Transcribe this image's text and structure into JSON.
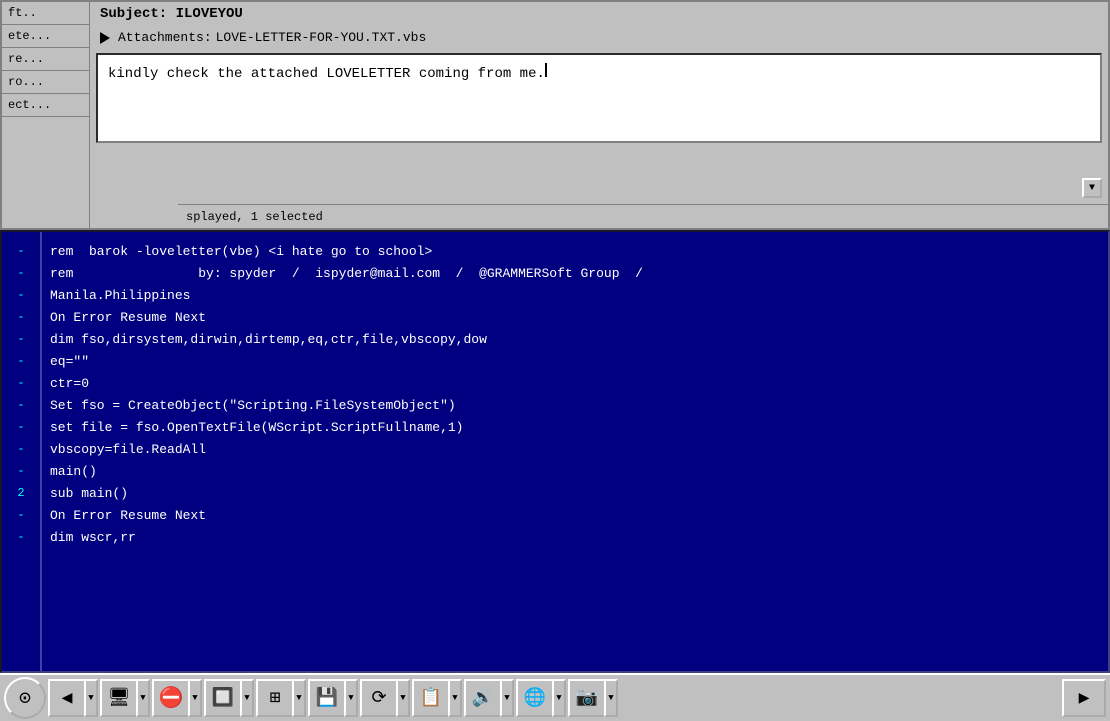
{
  "email": {
    "sidebar": {
      "items": [
        {
          "label": "ft.."
        },
        {
          "label": "ete..."
        },
        {
          "label": "re..."
        },
        {
          "label": "ro..."
        },
        {
          "label": "ect..."
        }
      ]
    },
    "subject": "Subject: ILOVEYOU",
    "attachment_label": "Attachments:",
    "attachment_file": "LOVE-LETTER-FOR-YOU.TXT.vbs",
    "body": "kindly check the attached LOVELETTER coming from me.",
    "status": "splayed, 1 selected"
  },
  "code": {
    "lines": [
      {
        "gutter": "-",
        "text": "rem  barok -loveletter(vbe) <i hate go to school>"
      },
      {
        "gutter": "-",
        "text": "rem                by: spyder  /  ispyder@mail.com  /  @GRAMMERSoft Group  /"
      },
      {
        "gutter": "-",
        "text": "Manila.Philippines"
      },
      {
        "gutter": "-",
        "text": "On Error Resume Next"
      },
      {
        "gutter": "-",
        "text": "dim fso,dirsystem,dirwin,dirtemp,eq,ctr,file,vbscopy,dow"
      },
      {
        "gutter": "-",
        "text": "eq=\"\""
      },
      {
        "gutter": "-",
        "text": "ctr=0"
      },
      {
        "gutter": "-",
        "text": "Set fso = CreateObject(\"Scripting.FileSystemObject\")"
      },
      {
        "gutter": "-",
        "text": "set file = fso.OpenTextFile(WScript.ScriptFullname,1)"
      },
      {
        "gutter": "-",
        "text": "vbscopy=file.ReadAll"
      },
      {
        "gutter": "-",
        "text": "main()"
      },
      {
        "gutter": "2",
        "text": "sub main()"
      },
      {
        "gutter": "-",
        "text": "On Error Resume Next"
      },
      {
        "gutter": "-",
        "text": "dim wscr,rr"
      }
    ]
  },
  "taskbar": {
    "buttons": [
      {
        "icon": "⊙",
        "label": "start"
      },
      {
        "icon": "◀",
        "label": "back"
      },
      {
        "icon": "🖥",
        "label": "desktop"
      },
      {
        "icon": "⛔",
        "label": "stop"
      },
      {
        "icon": "🔲",
        "label": "window"
      },
      {
        "icon": "⊞",
        "label": "grid"
      },
      {
        "icon": "💾",
        "label": "save"
      },
      {
        "icon": "⟳",
        "label": "refresh"
      },
      {
        "icon": "📋",
        "label": "clipboard"
      },
      {
        "icon": "🔊",
        "label": "sound"
      },
      {
        "icon": "🌐",
        "label": "internet"
      },
      {
        "icon": "📷",
        "label": "camera"
      }
    ],
    "end_icon": "▶"
  }
}
